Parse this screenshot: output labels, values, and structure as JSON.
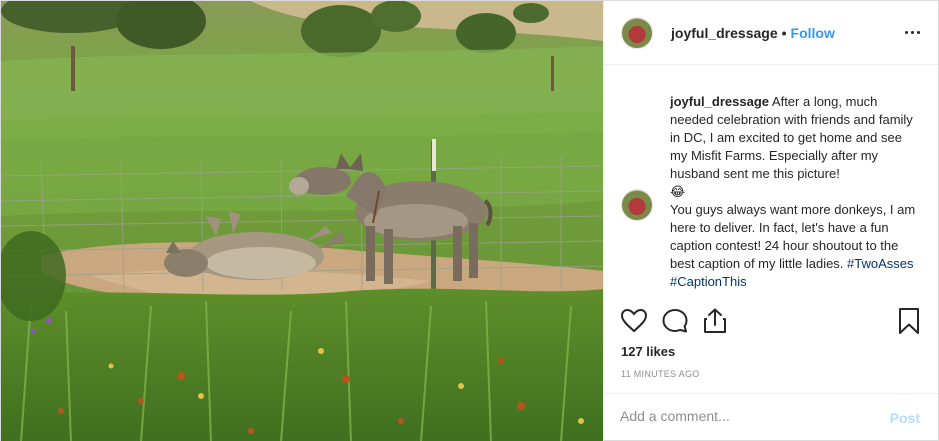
{
  "header": {
    "username": "joyful_dressage",
    "separator": "•",
    "follow_label": "Follow",
    "more_icon": "more-options-icon"
  },
  "caption": {
    "username": "joyful_dressage",
    "text_1": "After a long, much needed celebration with friends and family in DC, I am excited to get home and see my Misfit Farms. Especially after my husband sent me this picture!",
    "emoji": "😂",
    "text_2": "You guys always want more donkeys, I am here to deliver. In fact, let's have a fun caption contest! 24 hour shoutout to the best caption of my little ladies.",
    "hashtag_1": "#TwoAsses",
    "hashtag_2": "#CaptionThis"
  },
  "actions": {
    "icons": [
      "heart-icon",
      "comment-icon",
      "share-icon",
      "bookmark-icon"
    ]
  },
  "likes_text": "127 likes",
  "timestamp": "11 MINUTES AGO",
  "comment": {
    "placeholder": "Add a comment...",
    "post_label": "Post"
  },
  "colors": {
    "follow": "#3897f0",
    "hashtag": "#003569",
    "post_disabled": "#b3dbff",
    "muted": "#8e8e8e",
    "text": "#262626",
    "border": "#efefef"
  }
}
